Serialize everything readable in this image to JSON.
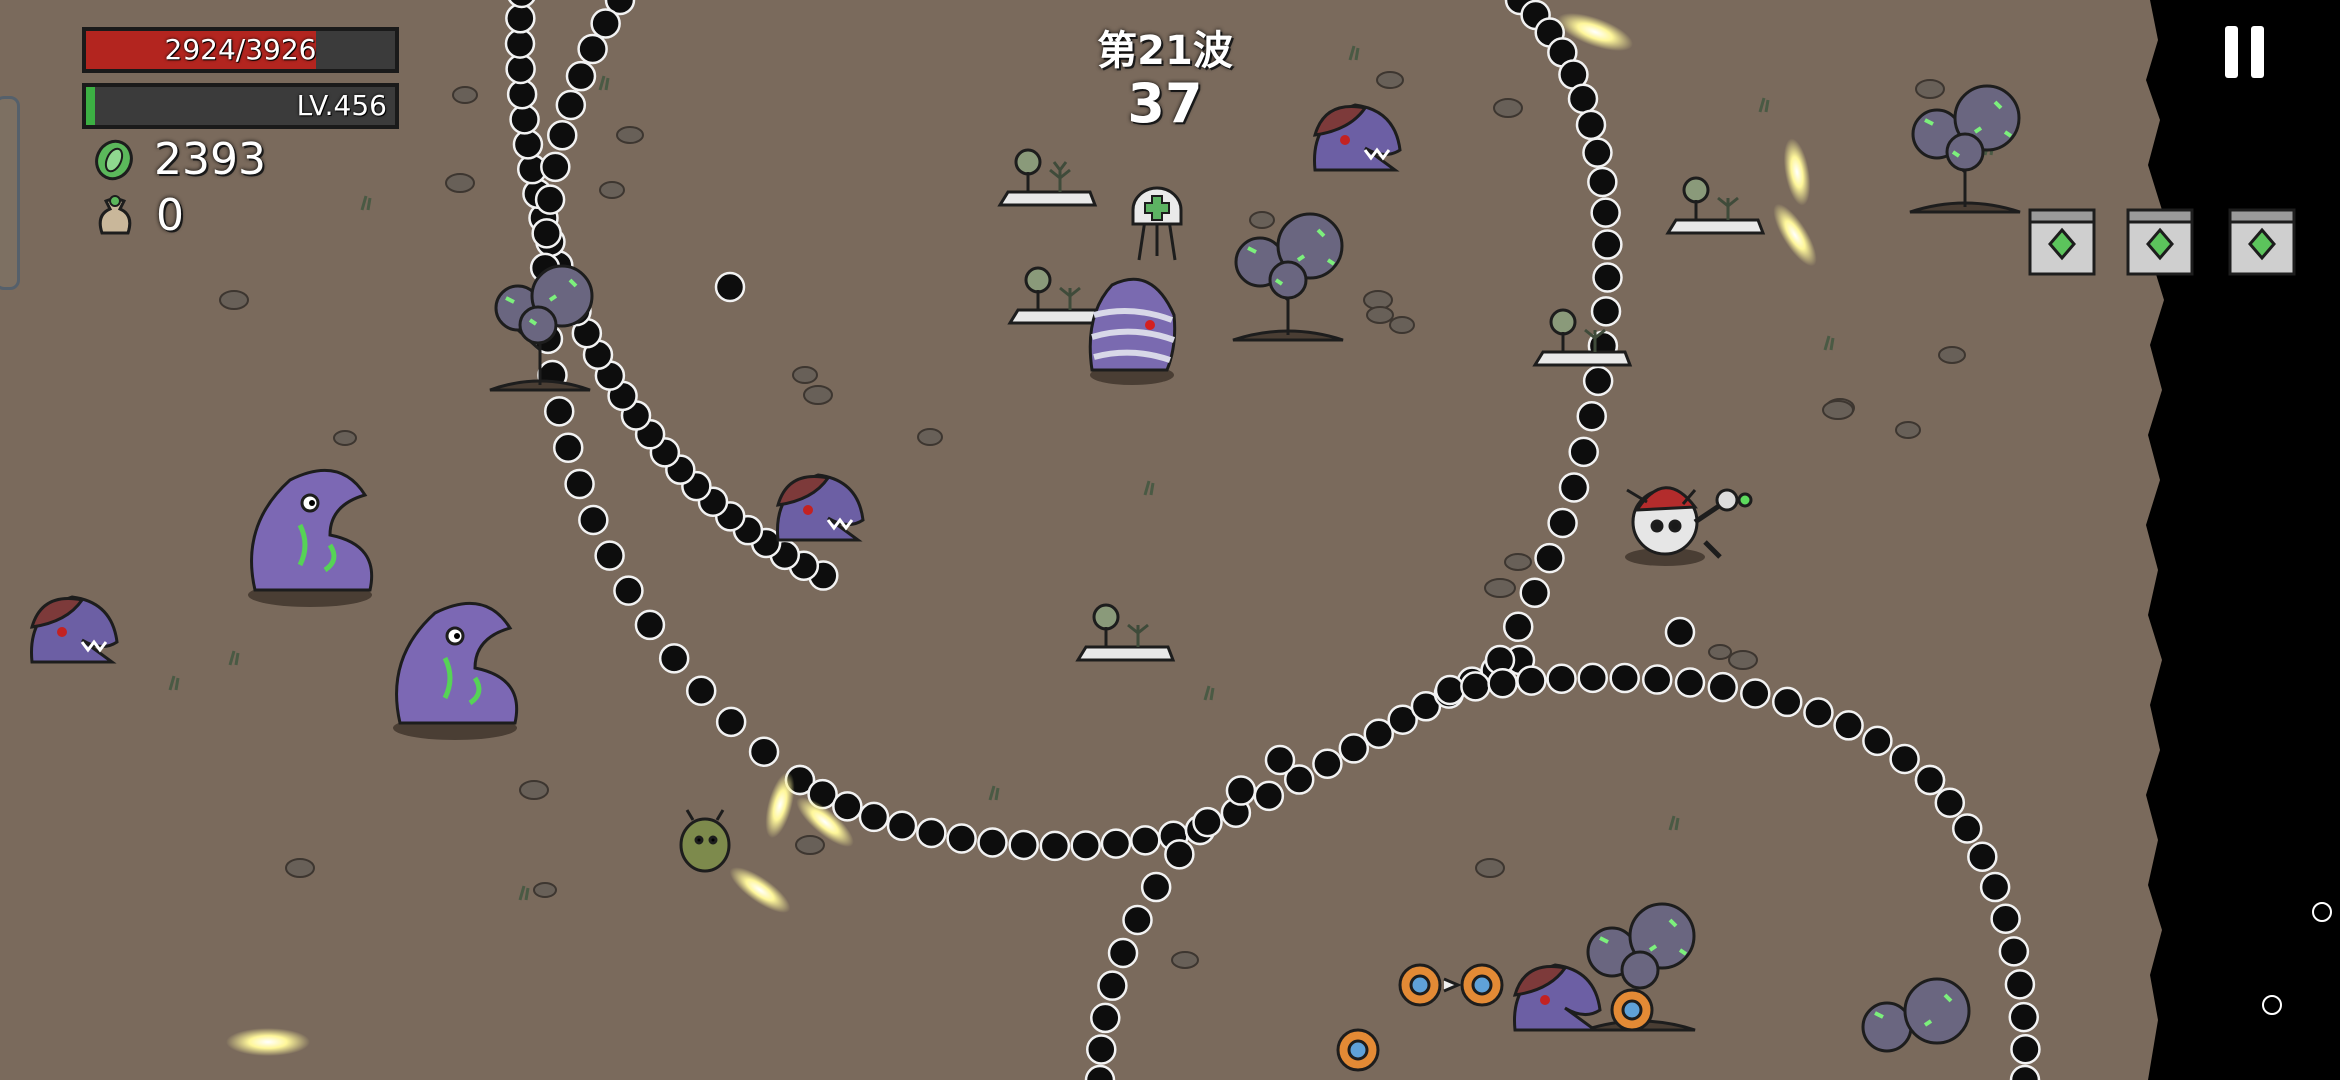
{
  "hud": {
    "hp_text": "2924/3926",
    "hp_fraction": 0.745,
    "level_text": "LV.456",
    "xp_fraction": 0.03,
    "materials_value": "2393",
    "bag_value": "0",
    "materials_icon": "green-coin-icon",
    "bag_icon": "money-bag-icon"
  },
  "wave": {
    "title": "第21波",
    "timer": "37"
  },
  "controls": {
    "pause_icon": "pause-icon"
  },
  "colors": {
    "ground": "#7a6a5c",
    "hp": "#b3251f",
    "xp": "#3cb043",
    "enemy_purple": "#7c68b4",
    "projectile": "#fff79a",
    "void": "#000000"
  }
}
